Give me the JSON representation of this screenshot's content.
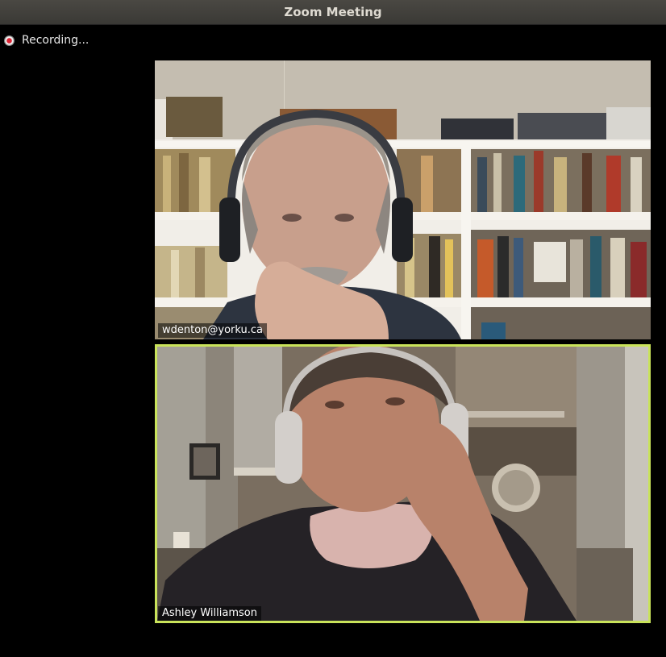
{
  "window": {
    "title": "Zoom Meeting"
  },
  "recording": {
    "label": "Recording...",
    "icon": "recording-dot-icon",
    "color": "#dd2233"
  },
  "participants": [
    {
      "name": "wdenton@yorku.ca"
    },
    {
      "name": "Ashley Williamson",
      "active_speaker": true,
      "highlight_color": "#c9e35a"
    }
  ]
}
